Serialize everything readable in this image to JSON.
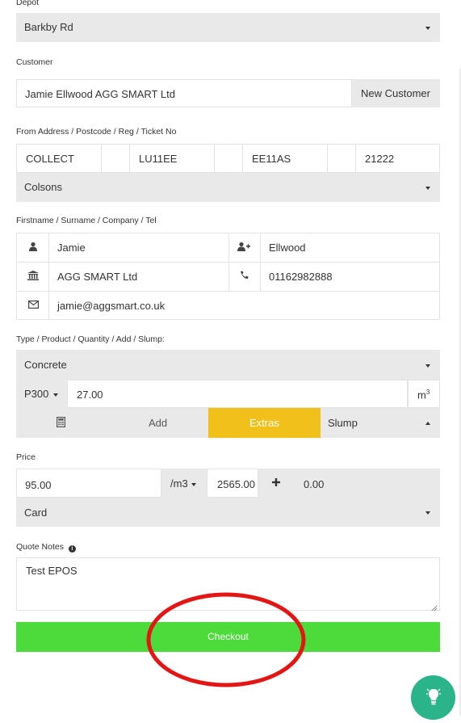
{
  "depot": {
    "label": "Depot",
    "value": "Barkby Rd"
  },
  "customer": {
    "label": "Customer",
    "value": "Jamie Ellwood AGG SMART Ltd",
    "new_button": "New Customer"
  },
  "from_address": {
    "label": "From Address / Postcode / Reg / Ticket No",
    "fields": [
      "COLLECT",
      "LU11EE",
      "EE11AS",
      "21222"
    ],
    "select": "Colsons"
  },
  "contact": {
    "label": "Firstname / Surname / Company / Tel",
    "firstname": "Jamie",
    "surname": "Ellwood",
    "company": "AGG SMART Ltd",
    "tel": "01162982888",
    "email": "jamie@aggsmart.co.uk"
  },
  "product": {
    "label": "Type / Product / Quantity / Add / Slump:",
    "type": "Concrete",
    "product_code": "P300",
    "quantity": "27.00",
    "unit": "m",
    "unit_sup": "3",
    "add_label": "Add",
    "extras_label": "Extras",
    "slump_label": "Slump"
  },
  "price": {
    "label": "Price",
    "unit_price": "95.00",
    "per_unit": "/m3",
    "total": "2565.00",
    "extra": "0.00",
    "payment": "Card"
  },
  "notes": {
    "label": "Quote Notes",
    "value": "Test EPOS"
  },
  "checkout": {
    "label": "Checkout"
  },
  "colors": {
    "accent_green": "#4cdb3a",
    "extras_yellow": "#f2c01a",
    "annotation_red": "#e31515",
    "help_teal": "#2bb389"
  },
  "icons": [
    "user-icon",
    "user-plus-icon",
    "bank-icon",
    "phone-icon",
    "envelope-icon",
    "calculator-icon",
    "plus-icon",
    "info-icon",
    "lightbulb-icon"
  ]
}
